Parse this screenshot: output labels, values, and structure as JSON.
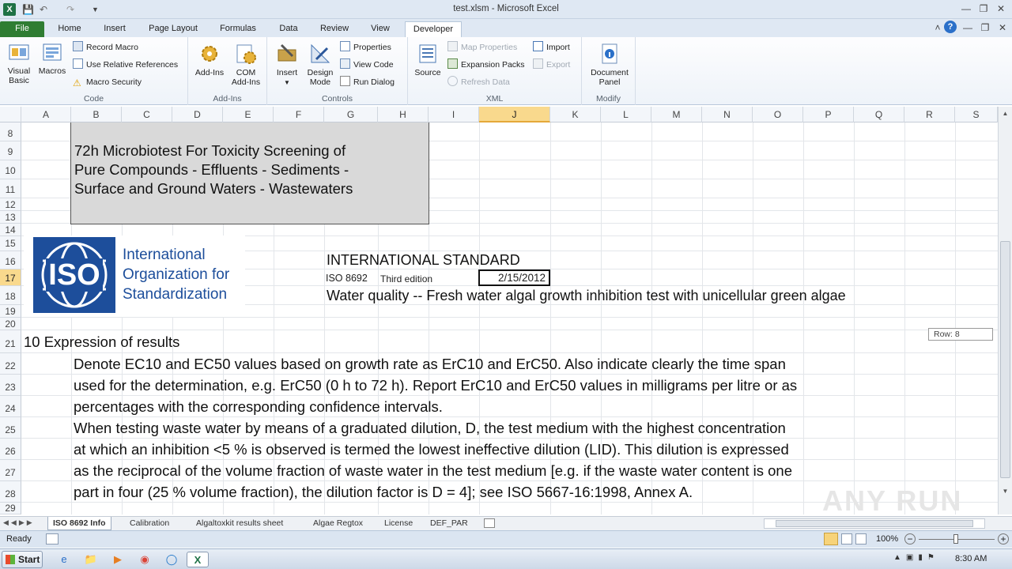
{
  "window": {
    "title": "test.xlsm - Microsoft Excel"
  },
  "tabs": [
    "File",
    "Home",
    "Insert",
    "Page Layout",
    "Formulas",
    "Data",
    "Review",
    "View",
    "Developer"
  ],
  "active_tab": "Developer",
  "ribbon": {
    "code": {
      "label": "Code",
      "visual_basic": "Visual Basic",
      "macros": "Macros",
      "record_macro": "Record Macro",
      "relative_refs": "Use Relative References",
      "macro_security": "Macro Security"
    },
    "addins": {
      "label": "Add-Ins",
      "addins": "Add-Ins",
      "com_addins": "COM Add-Ins"
    },
    "controls": {
      "label": "Controls",
      "insert": "Insert",
      "design_mode": "Design Mode",
      "properties": "Properties",
      "view_code": "View Code",
      "run_dialog": "Run Dialog"
    },
    "xml": {
      "label": "XML",
      "source": "Source",
      "map_properties": "Map Properties",
      "expansion_packs": "Expansion Packs",
      "refresh_data": "Refresh Data",
      "import": "Import",
      "export": "Export"
    },
    "modify": {
      "label": "Modify",
      "document_panel": "Document Panel"
    }
  },
  "columns": [
    "A",
    "B",
    "C",
    "D",
    "E",
    "F",
    "G",
    "H",
    "I",
    "J",
    "K",
    "L",
    "M",
    "N",
    "O",
    "P",
    "Q",
    "R",
    "S"
  ],
  "selected_column": "J",
  "selected_row": "17",
  "rows": [
    "8",
    "9",
    "10",
    "11",
    "12",
    "13",
    "14",
    "15",
    "16",
    "17",
    "18",
    "19",
    "20",
    "21",
    "22",
    "23",
    "24",
    "25",
    "26",
    "27",
    "28",
    "29"
  ],
  "sheet": {
    "title_box": [
      "72h Microbiotest For Toxicity Screening of",
      "Pure Compounds - Effluents - Sediments -",
      "Surface and Ground Waters - Wastewaters"
    ],
    "iso_logo_text": "ISO",
    "iso_org": [
      "International",
      "Organization for",
      "Standardization"
    ],
    "intl_standard": "INTERNATIONAL STANDARD",
    "iso_number": "ISO 8692",
    "edition": "Third edition",
    "date": "2/15/2012",
    "std_title": "Water quality -- Fresh water algal growth inhibition test with unicellular green algae",
    "section": "10 Expression of results",
    "paragraph": [
      "Denote EC10 and EC50 values based on growth rate as ErC10 and ErC50. Also indicate clearly the time span",
      "used for the determination, e.g. ErC50 (0 h to 72 h). Report ErC10 and ErC50 values in milligrams per litre or as",
      "percentages with the corresponding confidence intervals.",
      "When testing waste water by means of a graduated dilution, D, the test medium with the highest concentration",
      "at which an inhibition <5 % is observed is termed the lowest ineffective dilution (LID). This dilution is expressed",
      "as the reciprocal of the volume fraction of waste water in the test medium [e.g. if the waste water content is one",
      "part in four (25 % volume fraction), the dilution factor is D = 4]; see ISO 5667-16:1998, Annex A."
    ],
    "row_tooltip": "Row: 8"
  },
  "sheet_tabs": [
    "ISO 8692 Info",
    "Calibration",
    "Algaltoxkit results sheet",
    "Algae Regtox",
    "License",
    "DEF_PAR"
  ],
  "active_sheet": "ISO 8692 Info",
  "status": {
    "ready": "Ready",
    "zoom": "100%"
  },
  "taskbar": {
    "start": "Start",
    "clock": "8:30 AM"
  },
  "watermark": "ANY RUN"
}
